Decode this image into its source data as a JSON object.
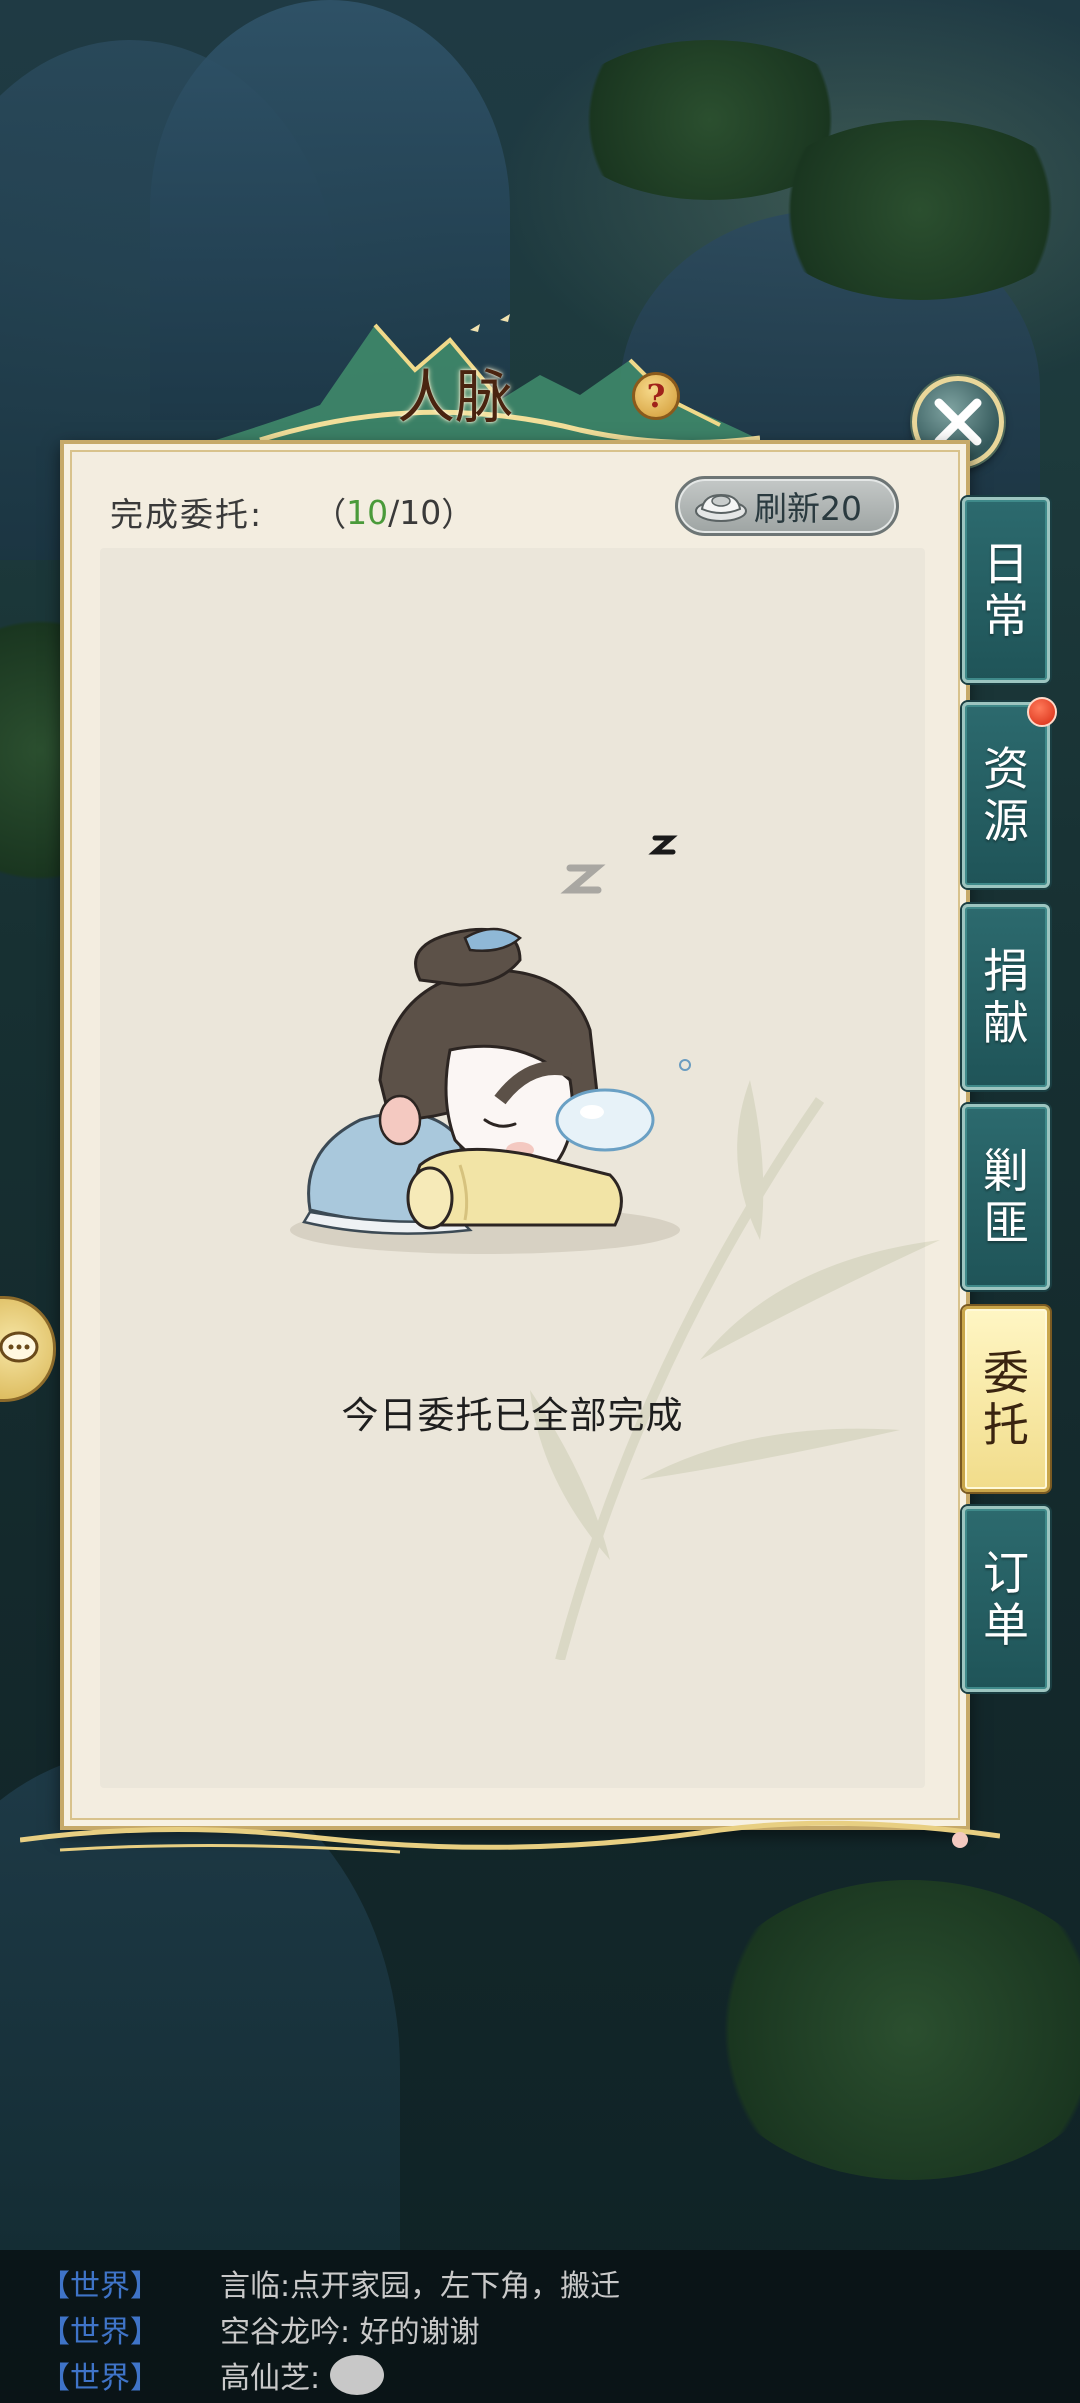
{
  "title": "人脉",
  "help_icon": "question-icon",
  "close_icon": "close-icon",
  "header": {
    "label": "完成委托:",
    "count_open": "（",
    "count_done": "10",
    "count_sep": "/",
    "count_total": "10",
    "count_close": "）"
  },
  "refresh": {
    "icon": "silver-ingot-icon",
    "label": "刷新20"
  },
  "empty_message": "今日委托已全部完成",
  "tabs": [
    {
      "char1": "日",
      "char2": "常",
      "active": false,
      "badge": false
    },
    {
      "char1": "资",
      "char2": "源",
      "active": false,
      "badge": true
    },
    {
      "char1": "捐",
      "char2": "献",
      "active": false,
      "badge": false
    },
    {
      "char1": "剿",
      "char2": "匪",
      "active": false,
      "badge": false
    },
    {
      "char1": "委",
      "char2": "托",
      "active": true,
      "badge": false
    },
    {
      "char1": "订",
      "char2": "单",
      "active": false,
      "badge": false
    }
  ],
  "chat": [
    {
      "channel": "【世界】",
      "message": "言临:点开家园，左下角，搬迁"
    },
    {
      "channel": "【世界】",
      "message": "空谷龙吟: 好的谢谢"
    },
    {
      "channel": "【世界】",
      "message": "高仙芝:"
    }
  ],
  "colors": {
    "done_count": "#4a9a3a",
    "tab_bg": "#2c6a6e",
    "tab_active_bg": "#f1dc8a",
    "badge": "#d62a12",
    "chat_channel": "#3f74c8"
  }
}
